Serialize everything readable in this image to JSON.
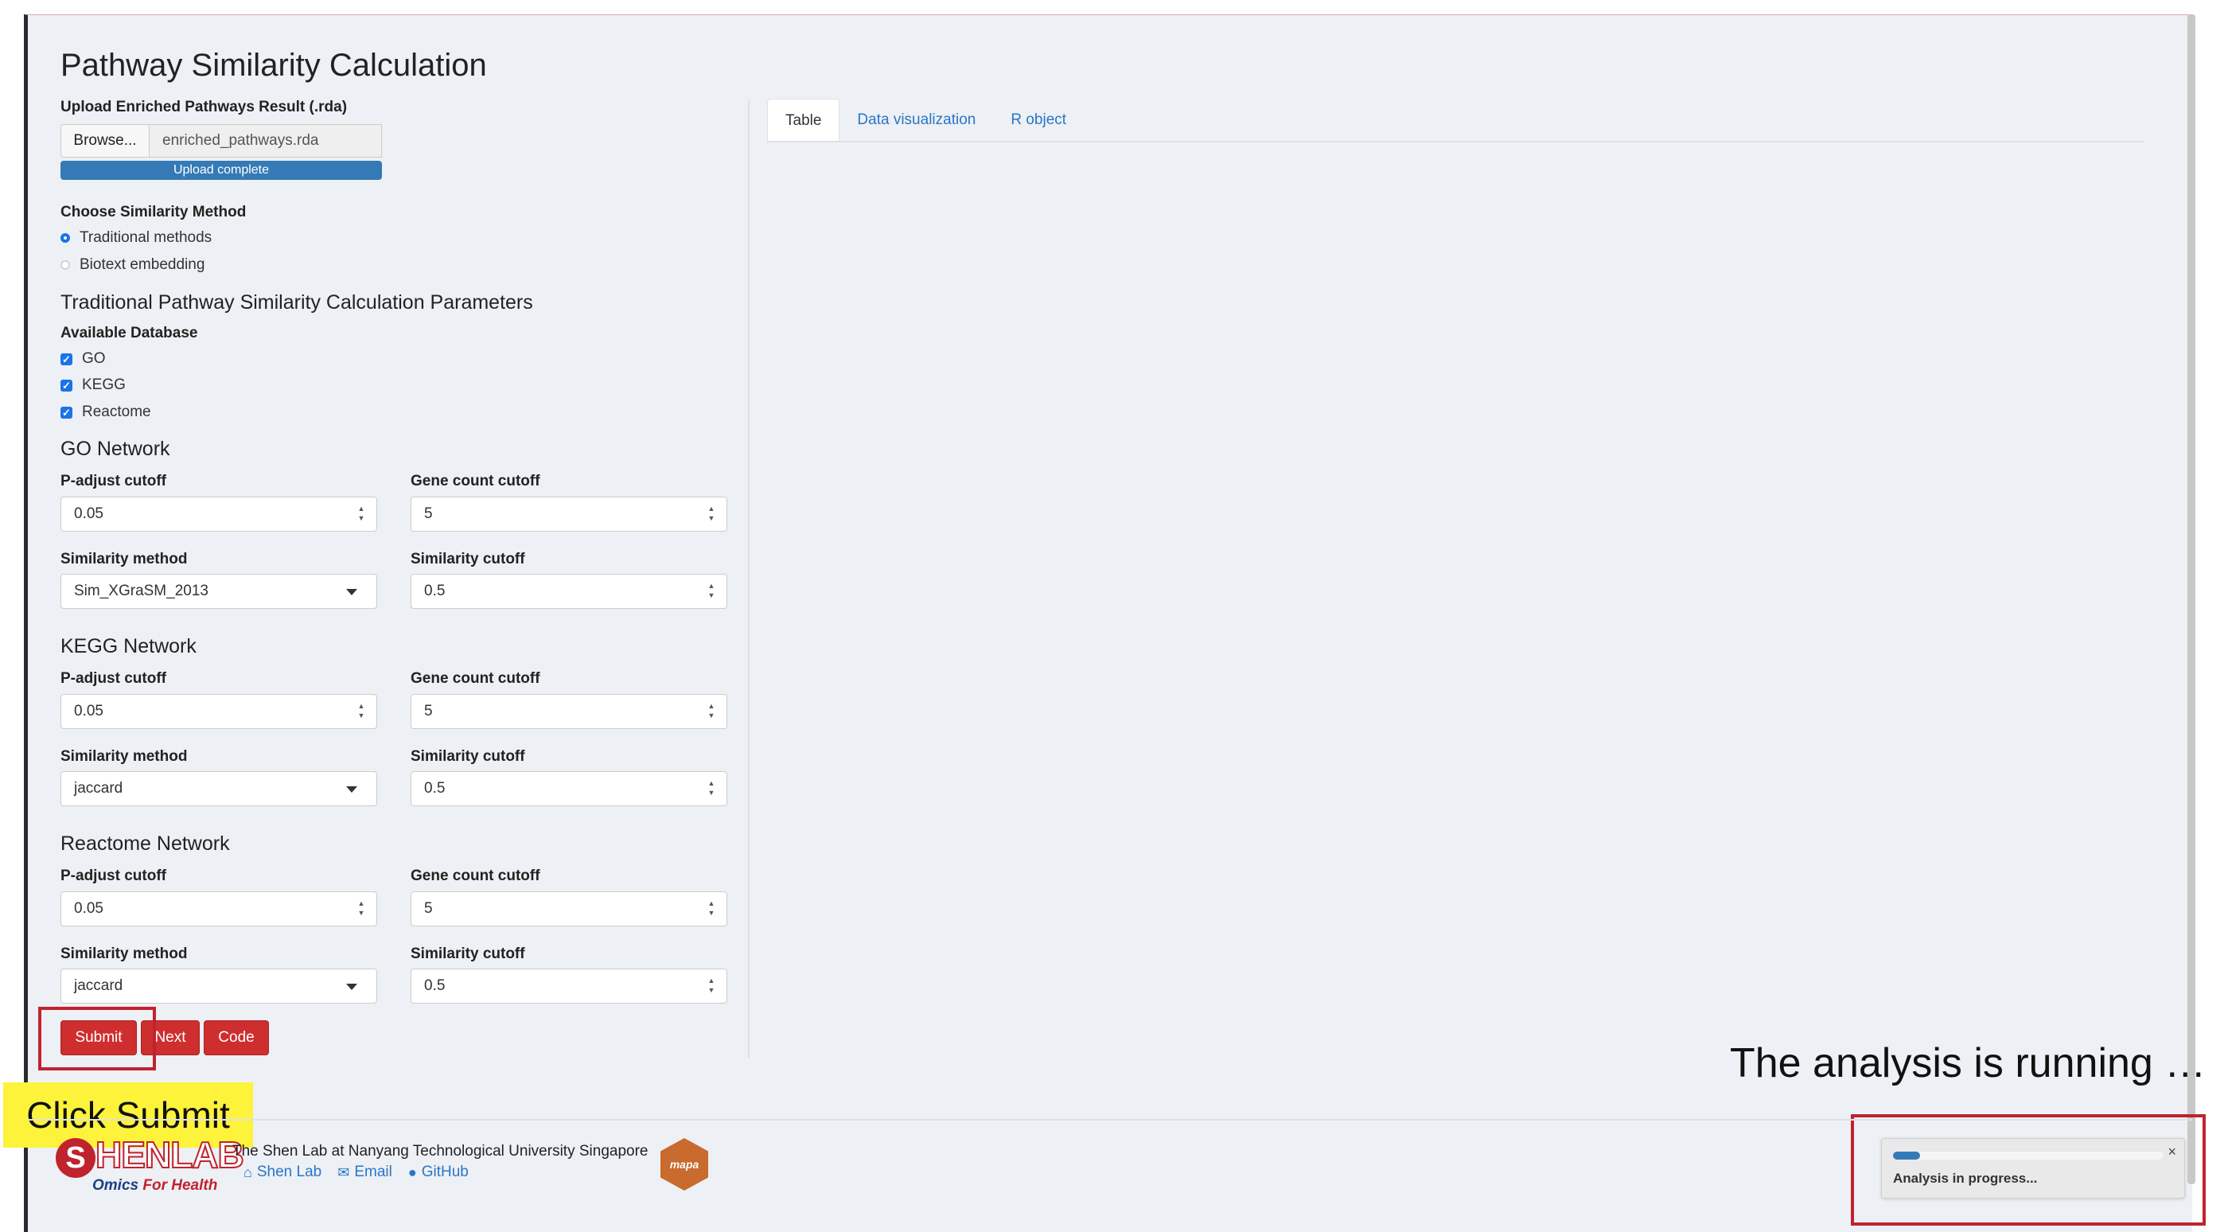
{
  "page": {
    "title": "Pathway Similarity Calculation"
  },
  "upload": {
    "label": "Upload Enriched Pathways Result (.rda)",
    "browse_label": "Browse...",
    "file_name": "enriched_pathways.rda",
    "status": "Upload complete",
    "progress_percent": 100
  },
  "method": {
    "label": "Choose Similarity Method",
    "options": [
      {
        "label": "Traditional methods",
        "selected": true
      },
      {
        "label": "Biotext embedding",
        "selected": false
      }
    ]
  },
  "params": {
    "heading": "Traditional Pathway Similarity Calculation Parameters",
    "db_label": "Available Database",
    "databases": [
      {
        "label": "GO",
        "checked": true
      },
      {
        "label": "KEGG",
        "checked": true
      },
      {
        "label": "Reactome",
        "checked": true
      }
    ]
  },
  "networks": [
    {
      "heading": "GO Network",
      "padj_label": "P-adjust cutoff",
      "padj": "0.05",
      "gene_label": "Gene count cutoff",
      "gene": "5",
      "sim_method_label": "Similarity method",
      "sim_method": "Sim_XGraSM_2013",
      "sim_cutoff_label": "Similarity cutoff",
      "sim_cutoff": "0.5"
    },
    {
      "heading": "KEGG Network",
      "padj_label": "P-adjust cutoff",
      "padj": "0.05",
      "gene_label": "Gene count cutoff",
      "gene": "5",
      "sim_method_label": "Similarity method",
      "sim_method": "jaccard",
      "sim_cutoff_label": "Similarity cutoff",
      "sim_cutoff": "0.5"
    },
    {
      "heading": "Reactome Network",
      "padj_label": "P-adjust cutoff",
      "padj": "0.05",
      "gene_label": "Gene count cutoff",
      "gene": "5",
      "sim_method_label": "Similarity method",
      "sim_method": "jaccard",
      "sim_cutoff_label": "Similarity cutoff",
      "sim_cutoff": "0.5"
    }
  ],
  "buttons": {
    "submit": "Submit",
    "next": "Next",
    "code": "Code"
  },
  "tabs": [
    "Table",
    "Data visualization",
    "R object"
  ],
  "annotations": {
    "click_hint": "Click Submit",
    "running": "The analysis is running …"
  },
  "notification": {
    "message": "Analysis in progress...",
    "close": "×",
    "progress_percent": 10
  },
  "footer": {
    "logo_text": "HENLAB",
    "logo_s": "S",
    "tagline_a": "Omics ",
    "tagline_b": "For Health",
    "org": "The Shen Lab at Nanyang Technological University Singapore",
    "links": [
      {
        "label": "Shen Lab",
        "icon": "home-icon"
      },
      {
        "label": "Email",
        "icon": "envelope-icon"
      },
      {
        "label": "GitHub",
        "icon": "github-icon"
      }
    ],
    "hex_label": "mapa"
  },
  "colors": {
    "accent": "#cf2e2e",
    "link": "#2a76c6",
    "progress": "#337ab7",
    "highlight": "#c0232e",
    "callout": "#fdf33a"
  }
}
